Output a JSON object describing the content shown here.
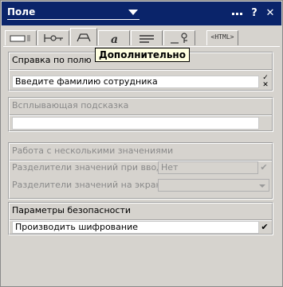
{
  "window": {
    "title": "Поле",
    "icons": [
      "dots-menu-icon",
      "help-icon",
      "close-icon"
    ],
    "help_glyph": "?",
    "close_glyph": "✕"
  },
  "tabs": {
    "items": [
      {
        "icon": "field-box-icon"
      },
      {
        "icon": "key-arrow-icon"
      },
      {
        "icon": "advanced-icon"
      },
      {
        "icon": "italic-a-icon"
      },
      {
        "icon": "paragraph-icon"
      },
      {
        "icon": "key-tag-icon"
      },
      {
        "icon": "html-icon",
        "label": "<HTML>"
      }
    ],
    "active_index": 2,
    "tooltip": "Дополнительно"
  },
  "help_section": {
    "heading": "Справка по полю",
    "value": "Введите фамилию сотрудника"
  },
  "popup_section": {
    "heading": "Всплывающая подсказка",
    "value": ""
  },
  "multi_section": {
    "heading": "Работа с несколькими значениями",
    "input_sep_label": "Разделители значений при вводе",
    "input_sep_value": "Нет",
    "display_sep_label": "Разделители значений на экране",
    "display_sep_value": ""
  },
  "security_section": {
    "heading": "Параметры безопасности",
    "value": "Производить шифрование",
    "check_glyph": "✔"
  },
  "colors": {
    "titlebar": "#0a246a",
    "panel": "#d6d3ce",
    "tooltip_bg": "#ffffe1",
    "disabled_text": "#8a8a8a"
  }
}
